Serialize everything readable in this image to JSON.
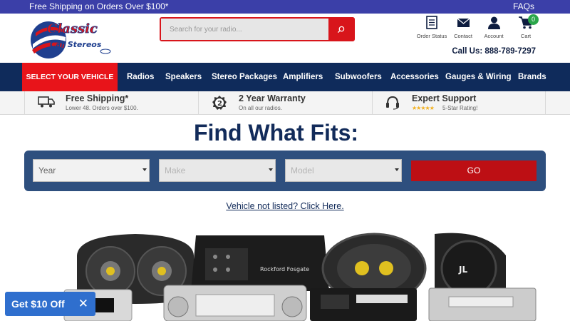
{
  "topbar": {
    "promo": "Free Shipping on Orders Over $100*",
    "faqs": "FAQs"
  },
  "header": {
    "search_placeholder": "Search for your radio...",
    "icons": [
      {
        "label": "Order Status",
        "icon": "clipboard-icon"
      },
      {
        "label": "Contact",
        "icon": "envelope-icon"
      },
      {
        "label": "Account",
        "icon": "user-icon"
      },
      {
        "label": "Cart",
        "icon": "cart-icon",
        "badge": "0"
      }
    ],
    "call": "Call Us: 888-789-7297"
  },
  "nav": {
    "select_vehicle": "SELECT YOUR VEHICLE",
    "items": [
      "Radios",
      "Speakers",
      "Stereo Packages",
      "Amplifiers",
      "Subwoofers",
      "Accessories",
      "Gauges & Wiring",
      "Brands"
    ]
  },
  "benefits": [
    {
      "title": "Free Shipping*",
      "sub": "Lower 48. Orders over $100.",
      "icon": "truck-icon"
    },
    {
      "title": "2 Year Warranty",
      "sub": "On all our radios.",
      "icon": "warranty-badge-icon"
    },
    {
      "title": "Expert Support",
      "stars": "★★★★★",
      "sub": "5-Star Rating!",
      "icon": "headset-icon"
    }
  ],
  "finder": {
    "title": "Find What Fits:",
    "year": "Year",
    "make": "Make",
    "model": "Model",
    "go": "GO",
    "not_listed": "Vehicle not listed? Click Here."
  },
  "products": {
    "amp_brand": "Rockford Fosgate"
  },
  "promo_tab": {
    "label": "Get $10 Off",
    "close": "✕"
  },
  "colors": {
    "nav_bg": "#0f2b5b",
    "accent_red": "#e8141a",
    "topbar_bg": "#3b3fa8",
    "finder_bg": "#2e4f7e",
    "promo_blue": "#2f6fce"
  }
}
